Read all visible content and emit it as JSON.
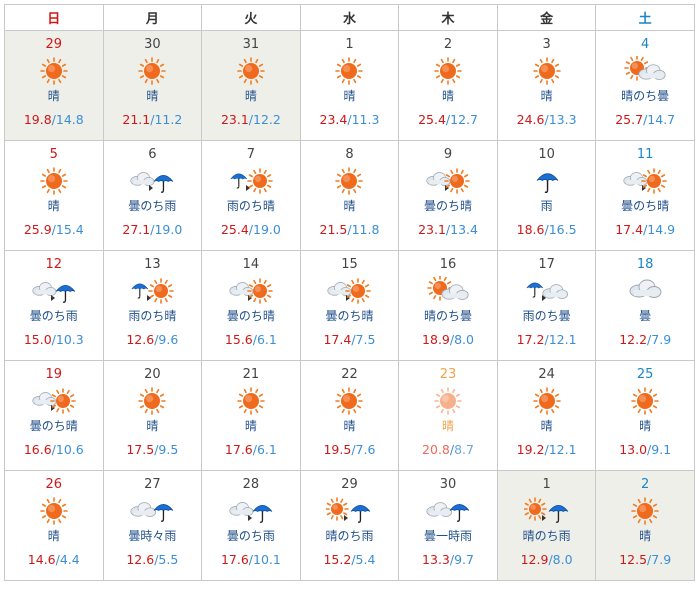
{
  "weekdays": [
    "日",
    "月",
    "火",
    "水",
    "木",
    "金",
    "土"
  ],
  "colors": {
    "sunday": "#d01818",
    "saturday": "#1a86c8",
    "high_temp": "#d01818",
    "low_temp": "#3b8fd6",
    "weather_text": "#1f4f8a",
    "today": "#f2a24a",
    "out_of_month_bg": "#efefea"
  },
  "weeks": [
    [
      {
        "day": "29",
        "weather": "晴",
        "icon": "sun-icon",
        "high": "19.8",
        "low": "14.8",
        "out": true
      },
      {
        "day": "30",
        "weather": "晴",
        "icon": "sun-icon",
        "high": "21.1",
        "low": "11.2",
        "out": true
      },
      {
        "day": "31",
        "weather": "晴",
        "icon": "sun-icon",
        "high": "23.1",
        "low": "12.2",
        "out": true
      },
      {
        "day": "1",
        "weather": "晴",
        "icon": "sun-icon",
        "high": "23.4",
        "low": "11.3"
      },
      {
        "day": "2",
        "weather": "晴",
        "icon": "sun-icon",
        "high": "25.4",
        "low": "12.7"
      },
      {
        "day": "3",
        "weather": "晴",
        "icon": "sun-icon",
        "high": "24.6",
        "low": "13.3"
      },
      {
        "day": "4",
        "weather": "晴のち曇",
        "icon": "sun-then-cloud-icon",
        "high": "25.7",
        "low": "14.7"
      }
    ],
    [
      {
        "day": "5",
        "weather": "晴",
        "icon": "sun-icon",
        "high": "25.9",
        "low": "15.4"
      },
      {
        "day": "6",
        "weather": "曇のち雨",
        "icon": "cloud-then-rain-icon",
        "high": "27.1",
        "low": "19.0"
      },
      {
        "day": "7",
        "weather": "雨のち晴",
        "icon": "rain-then-sun-icon",
        "high": "25.4",
        "low": "19.0"
      },
      {
        "day": "8",
        "weather": "晴",
        "icon": "sun-icon",
        "high": "21.5",
        "low": "11.8"
      },
      {
        "day": "9",
        "weather": "曇のち晴",
        "icon": "cloud-then-sun-icon",
        "high": "23.1",
        "low": "13.4"
      },
      {
        "day": "10",
        "weather": "雨",
        "icon": "rain-icon",
        "high": "18.6",
        "low": "16.5"
      },
      {
        "day": "11",
        "weather": "曇のち晴",
        "icon": "cloud-then-sun-icon",
        "high": "17.4",
        "low": "14.9"
      }
    ],
    [
      {
        "day": "12",
        "weather": "曇のち雨",
        "icon": "cloud-then-rain-icon",
        "high": "15.0",
        "low": "10.3"
      },
      {
        "day": "13",
        "weather": "雨のち晴",
        "icon": "rain-then-sun-icon",
        "high": "12.6",
        "low": "9.6"
      },
      {
        "day": "14",
        "weather": "曇のち晴",
        "icon": "cloud-then-sun-icon",
        "high": "15.6",
        "low": "6.1"
      },
      {
        "day": "15",
        "weather": "曇のち晴",
        "icon": "cloud-then-sun-icon",
        "high": "17.4",
        "low": "7.5"
      },
      {
        "day": "16",
        "weather": "晴のち曇",
        "icon": "sun-then-cloud-icon",
        "high": "18.9",
        "low": "8.0"
      },
      {
        "day": "17",
        "weather": "雨のち曇",
        "icon": "rain-then-cloud-icon",
        "high": "17.2",
        "low": "12.1"
      },
      {
        "day": "18",
        "weather": "曇",
        "icon": "cloud-icon",
        "high": "12.2",
        "low": "7.9"
      }
    ],
    [
      {
        "day": "19",
        "weather": "曇のち晴",
        "icon": "cloud-then-sun-icon",
        "high": "16.6",
        "low": "10.6"
      },
      {
        "day": "20",
        "weather": "晴",
        "icon": "sun-icon",
        "high": "17.5",
        "low": "9.5"
      },
      {
        "day": "21",
        "weather": "晴",
        "icon": "sun-icon",
        "high": "17.6",
        "low": "6.1"
      },
      {
        "day": "22",
        "weather": "晴",
        "icon": "sun-icon",
        "high": "19.5",
        "low": "7.6"
      },
      {
        "day": "23",
        "weather": "晴",
        "icon": "sun-icon",
        "high": "20.8",
        "low": "8.7",
        "today": true
      },
      {
        "day": "24",
        "weather": "晴",
        "icon": "sun-icon",
        "high": "19.2",
        "low": "12.1"
      },
      {
        "day": "25",
        "weather": "晴",
        "icon": "sun-icon",
        "high": "13.0",
        "low": "9.1"
      }
    ],
    [
      {
        "day": "26",
        "weather": "晴",
        "icon": "sun-icon",
        "high": "14.6",
        "low": "4.4"
      },
      {
        "day": "27",
        "weather": "曇時々雨",
        "icon": "cloud-sometimes-rain-icon",
        "high": "12.6",
        "low": "5.5"
      },
      {
        "day": "28",
        "weather": "曇のち雨",
        "icon": "cloud-then-rain-icon",
        "high": "17.6",
        "low": "10.1"
      },
      {
        "day": "29",
        "weather": "晴のち雨",
        "icon": "sun-then-rain-icon",
        "high": "15.2",
        "low": "5.4"
      },
      {
        "day": "30",
        "weather": "曇一時雨",
        "icon": "cloud-briefly-rain-icon",
        "high": "13.3",
        "low": "9.7"
      },
      {
        "day": "1",
        "weather": "晴のち雨",
        "icon": "sun-then-rain-icon",
        "high": "12.9",
        "low": "8.0",
        "out": true
      },
      {
        "day": "2",
        "weather": "晴",
        "icon": "sun-icon",
        "high": "12.5",
        "low": "7.9",
        "out": true
      }
    ]
  ]
}
